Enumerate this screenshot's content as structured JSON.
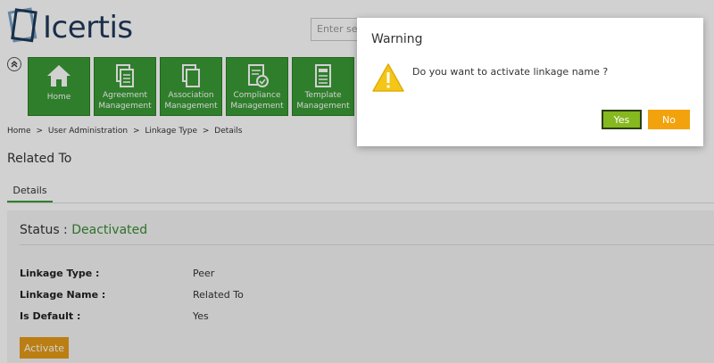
{
  "header": {
    "logo_text": "Icertis",
    "search_placeholder": "Enter sea"
  },
  "tiles": [
    {
      "line1": "Home",
      "line2": "",
      "icon": "home-icon"
    },
    {
      "line1": "Agreement",
      "line2": "Management",
      "icon": "agreement-icon"
    },
    {
      "line1": "Association",
      "line2": "Management",
      "icon": "association-icon"
    },
    {
      "line1": "Compliance",
      "line2": "Management",
      "icon": "compliance-icon"
    },
    {
      "line1": "Template",
      "line2": "Management",
      "icon": "template-icon"
    }
  ],
  "breadcrumb": {
    "items": [
      "Home",
      "User Administration",
      "Linkage Type",
      "Details"
    ],
    "separator": ">"
  },
  "page": {
    "title": "Related To",
    "tab_label": "Details"
  },
  "details": {
    "status_label": "Status :",
    "status_value": "Deactivated",
    "fields": [
      {
        "label": "Linkage Type :",
        "value": "Peer"
      },
      {
        "label": "Linkage Name :",
        "value": "Related To"
      },
      {
        "label": "Is Default :",
        "value": "Yes"
      }
    ],
    "activate_label": "Activate"
  },
  "dialog": {
    "title": "Warning",
    "message": "Do you want to activate linkage name ?",
    "yes_label": "Yes",
    "no_label": "No"
  },
  "colors": {
    "tile_green": "#3a9a35",
    "status_green": "#3a8a35",
    "activate_orange": "#e59a17",
    "yes_green": "#86b81f",
    "no_orange": "#f2a20c",
    "warning_yellow": "#f5c518"
  }
}
